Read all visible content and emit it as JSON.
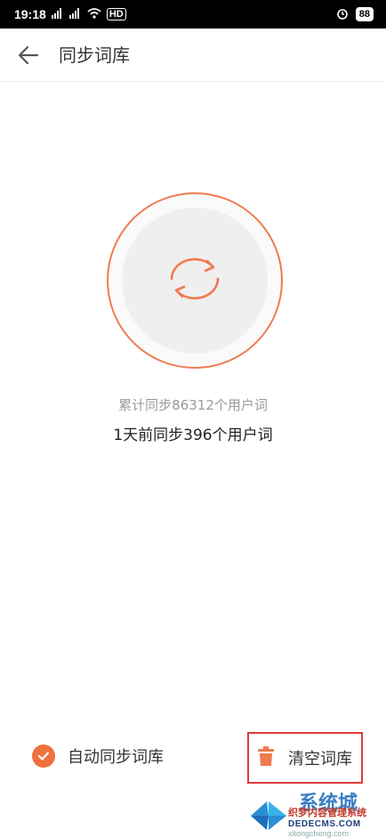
{
  "status_bar": {
    "time": "19:18",
    "network": "HD",
    "battery": "88"
  },
  "header": {
    "title": "同步词库"
  },
  "sync": {
    "total_text": "累计同步86312个用户词",
    "recent_text": "1天前同步396个用户词"
  },
  "bottom": {
    "auto_sync_label": "自动同步词库",
    "clear_label": "清空词库"
  },
  "watermark": {
    "brand": "系统城",
    "site_cn": "织梦内容管理系统",
    "site_url": "DEDECMS.COM",
    "domain": "xitongcheng.com"
  },
  "colors": {
    "accent": "#f07a4f",
    "highlight_border": "#e0393b"
  }
}
